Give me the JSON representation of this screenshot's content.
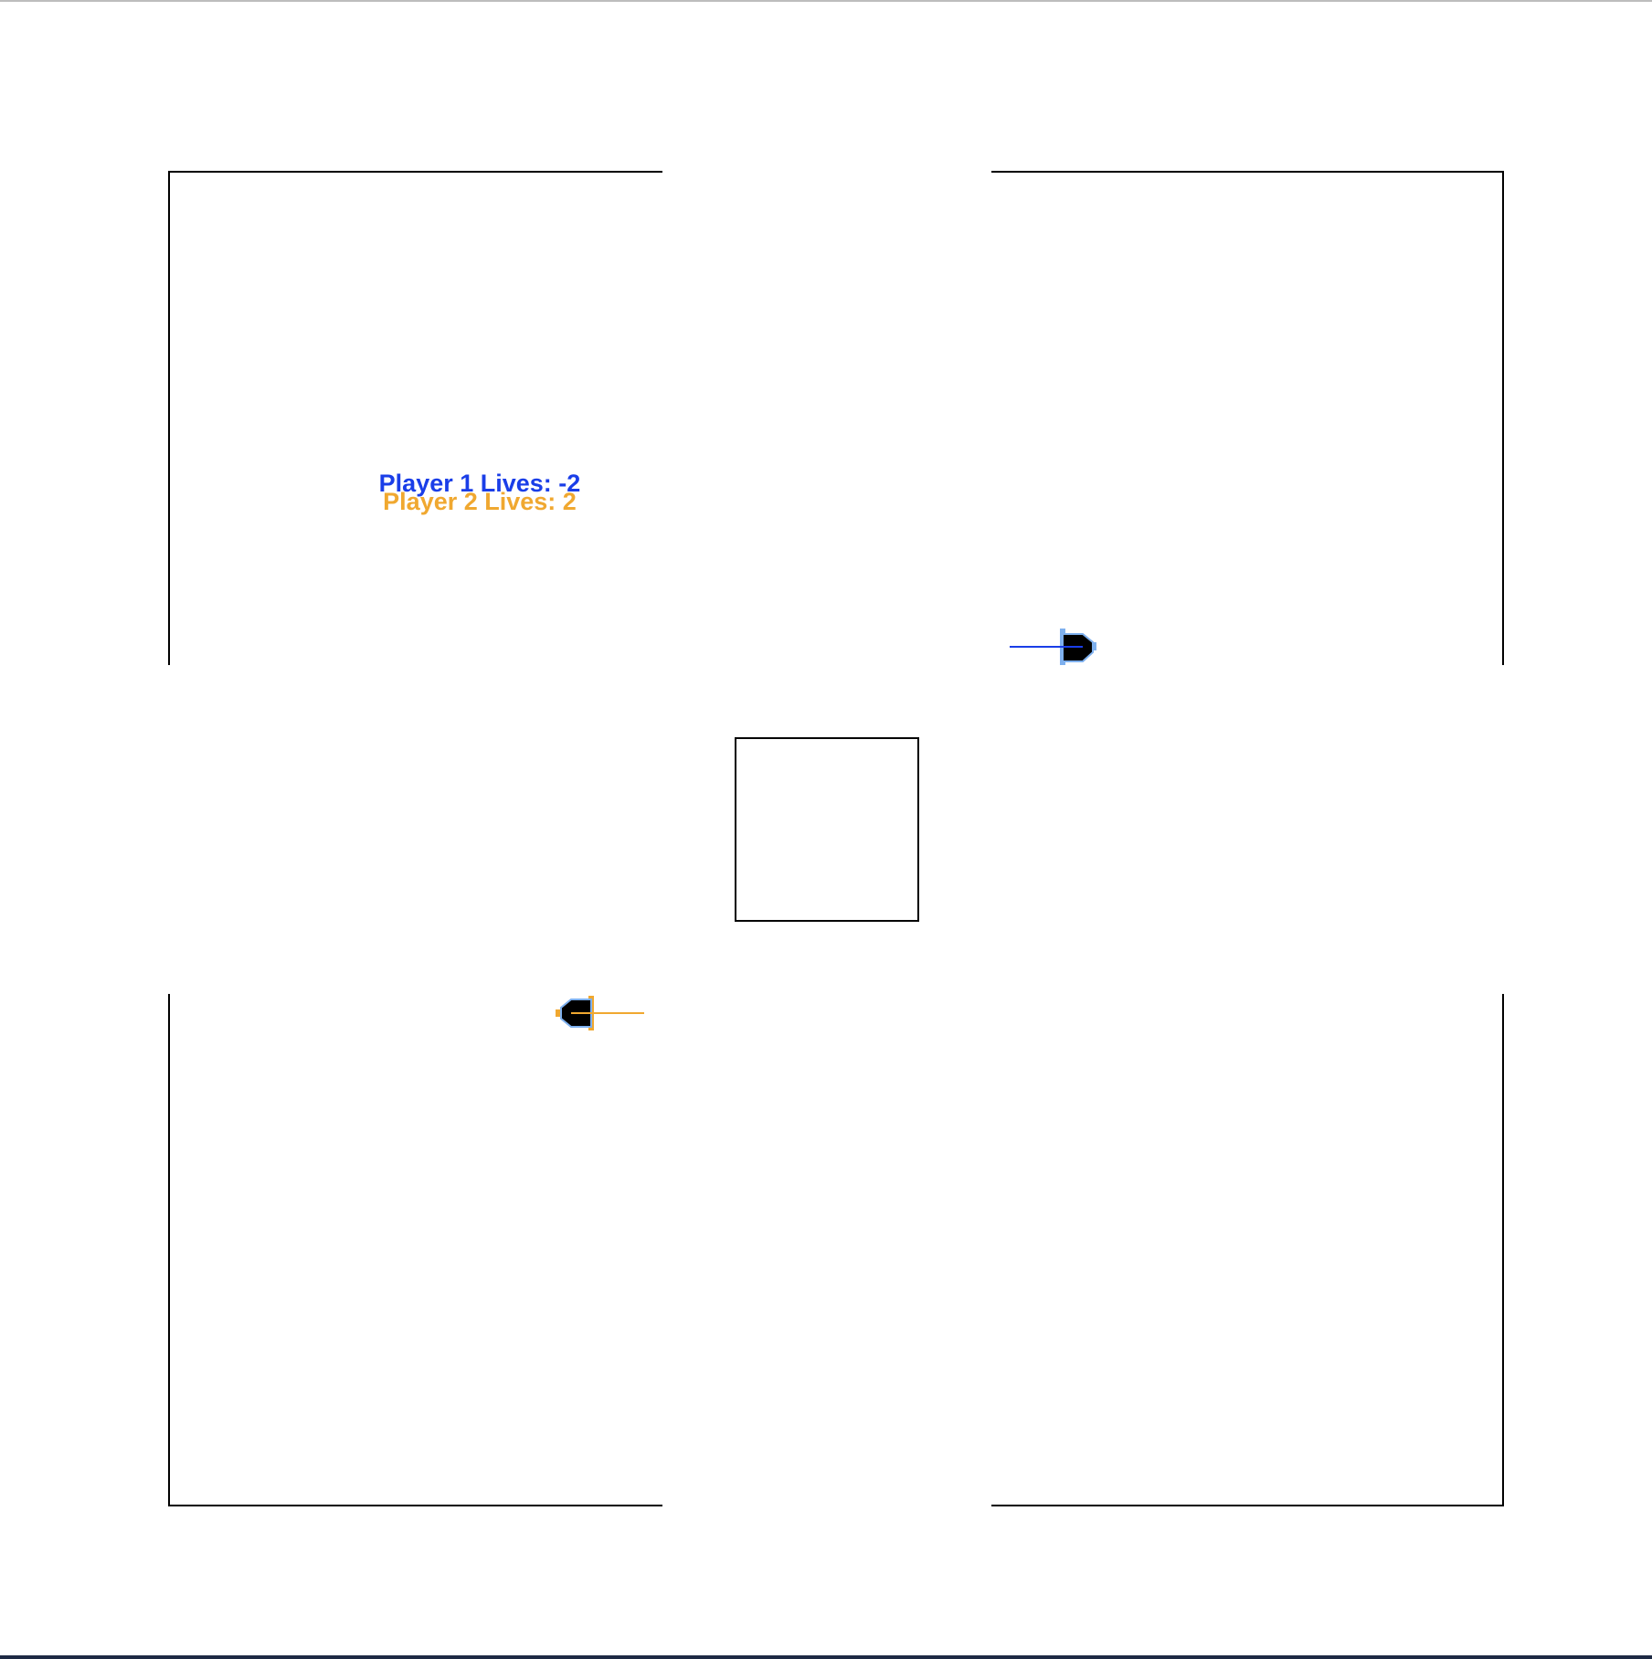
{
  "hud": {
    "player1_lives_text": "Player 1 Lives: -2",
    "player2_lives_text": "Player 2 Lives: 2",
    "player1_lives": -2,
    "player2_lives": 2
  },
  "colors": {
    "background": "#ffffff",
    "walls": "#000000",
    "player1": "#1a3ee8",
    "player1_light": "#7eb0ee",
    "player2": "#f0a830",
    "tank_body": "#000000"
  },
  "players": [
    {
      "name": "player-1",
      "facing": "right",
      "color_key": "player1"
    },
    {
      "name": "player-2",
      "facing": "left",
      "color_key": "player2"
    }
  ]
}
